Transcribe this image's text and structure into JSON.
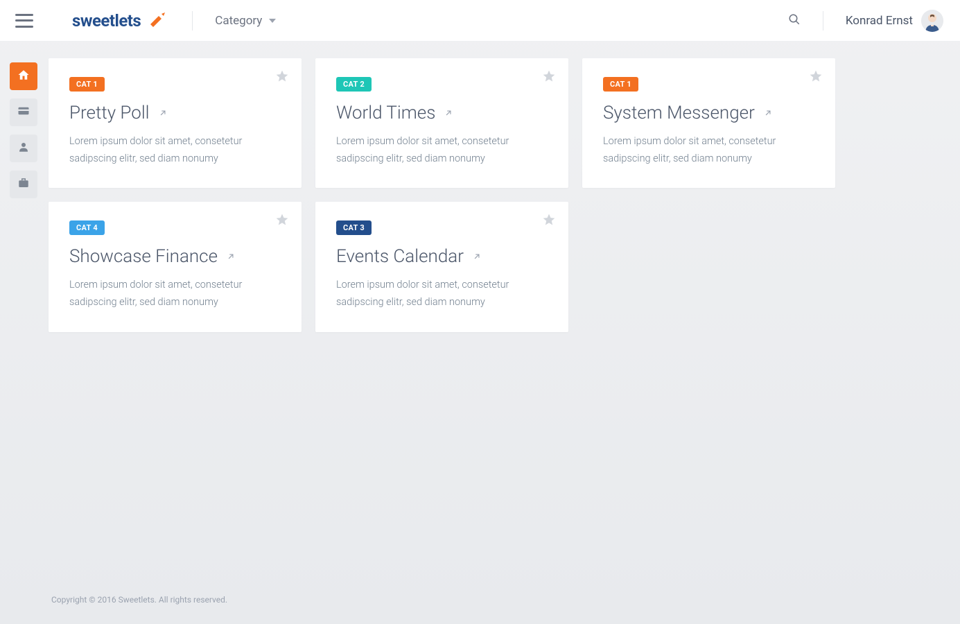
{
  "header": {
    "brand": "sweetlets",
    "category_label": "Category",
    "user_name": "Konrad Ernst"
  },
  "sidebar": {
    "items": [
      {
        "icon": "house-icon",
        "active": true
      },
      {
        "icon": "card-icon",
        "active": false
      },
      {
        "icon": "person-icon",
        "active": false
      },
      {
        "icon": "briefcase-icon",
        "active": false
      }
    ]
  },
  "cards": [
    {
      "cat_label": "CAT 1",
      "cat_class": "c1",
      "title": "Pretty Poll",
      "desc": "Lorem ipsum dolor sit amet, consetetur sadipscing elitr, sed diam nonumy"
    },
    {
      "cat_label": "CAT 2",
      "cat_class": "c2",
      "title": "World Times",
      "desc": "Lorem ipsum dolor sit amet, consetetur sadipscing elitr, sed diam nonumy"
    },
    {
      "cat_label": "CAT 1",
      "cat_class": "c1",
      "title": "System Messenger",
      "desc": "Lorem ipsum dolor sit amet, consetetur sadipscing elitr, sed diam nonumy"
    },
    {
      "cat_label": "CAT 4",
      "cat_class": "c4",
      "title": "Showcase Finance",
      "desc": "Lorem ipsum dolor sit amet, consetetur sadipscing elitr, sed diam nonumy"
    },
    {
      "cat_label": "CAT 3",
      "cat_class": "c3",
      "title": "Events Calendar",
      "desc": "Lorem ipsum dolor sit amet, consetetur sadipscing elitr, sed diam nonumy"
    }
  ],
  "footer": {
    "text": "Copyright © 2016 Sweetlets. All rights reserved."
  }
}
